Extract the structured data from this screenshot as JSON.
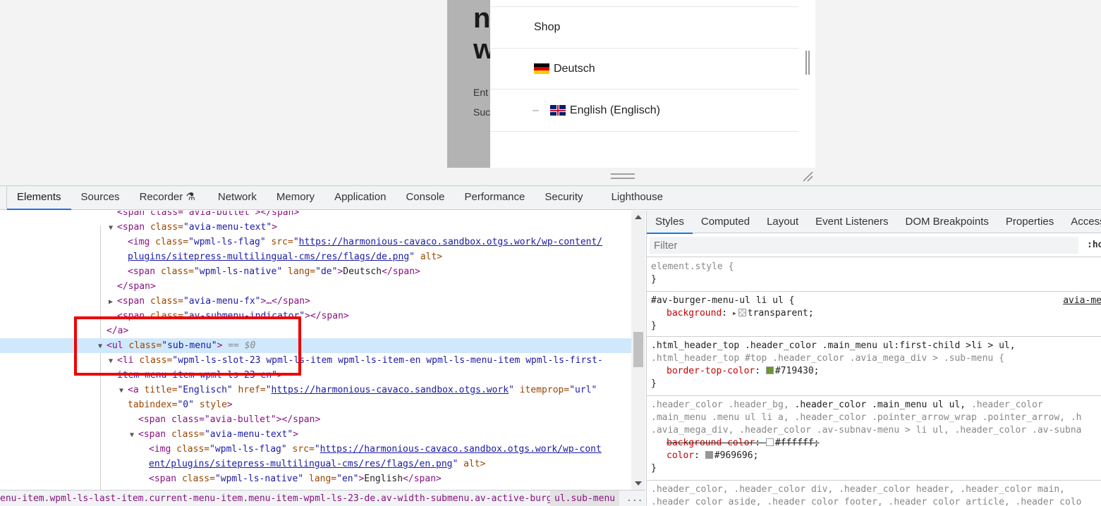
{
  "site": {
    "heading_line1": "n",
    "heading_line2": "w",
    "text_line1": "Ent",
    "text_line2": "Suc",
    "menu": {
      "shop": "Shop",
      "deutsch": "Deutsch",
      "english_dash": "–",
      "english": "English (Englisch)"
    }
  },
  "devtools": {
    "tabs": [
      "Elements",
      "Sources",
      "Recorder ⚗",
      "Network",
      "Memory",
      "Application",
      "Console",
      "Performance",
      "Security",
      "Lighthouse"
    ],
    "active_tab": "Elements",
    "dom": {
      "l0": "<span class=\"avia-bullet\"></span>",
      "l1_tag_open": "<span ",
      "l1_attr": "class=",
      "l1_val": "\"avia-menu-text\"",
      "l1_close": ">",
      "l2_pre": "<img ",
      "l2_attr1": "class=",
      "l2_val1": "\"wpml-ls-flag\"",
      "l2_attr2": " src=",
      "l2_link1": "https://harmonious-cavaco.sandbox.otgs.work/wp-content/",
      "l3_link2": "plugins/sitepress-multilingual-cms/res/flags/de.png",
      "l3_after": " alt>",
      "l4_open": "<span ",
      "l4_attr1": "class=",
      "l4_val1": "\"wpml-ls-native\"",
      "l4_attr2": " lang=",
      "l4_val2": "\"de\"",
      "l4_text": "Deutsch",
      "l4_close": "</span>",
      "l5": "</span>",
      "l6_open": "<span ",
      "l6_attr": "class=",
      "l6_val": "\"avia-menu-fx\"",
      "l6_rest": ">…</span>",
      "l7_open": "<span ",
      "l7_attr": "class=",
      "l7_val": "\"av-submenu-indicator\"",
      "l7_rest": "></span>",
      "l8": "</a>",
      "l9_open": "<ul ",
      "l9_attr": "class=",
      "l9_val": "\"sub-menu\"",
      "l9_close": ">",
      "l9_eq": " == $0",
      "l10_open": "<li ",
      "l10_attr": "class=",
      "l10_val": "\"wpml-ls-slot-23 wpml-ls-item wpml-ls-item-en wpml-ls-menu-item wpml-ls-first-",
      "l11_val": "item menu-item-wpml-ls-23-en\"",
      "l11_close": ">",
      "l12_open": "<a ",
      "l12_attr1": "title=",
      "l12_val1": "\"Englisch\"",
      "l12_attr2": " href=",
      "l12_link": "https://harmonious-cavaco.sandbox.otgs.work",
      "l12_attr3": " itemprop=",
      "l12_val3": "\"url\"",
      "l13_attr": "tabindex=",
      "l13_val": "\"0\"",
      "l13_attr2": " style",
      "l13_close": ">",
      "l14": "<span class=\"avia-bullet\"></span>",
      "l15_open": "<span ",
      "l15_attr": "class=",
      "l15_val": "\"avia-menu-text\"",
      "l15_close": ">",
      "l16_open": "<img ",
      "l16_attr1": "class=",
      "l16_val1": "\"wpml-ls-flag\"",
      "l16_attr2": " src=",
      "l16_link": "https://harmonious-cavaco.sandbox.otgs.work/wp-cont",
      "l17_link": "ent/plugins/sitepress-multilingual-cms/res/flags/en.png",
      "l17_after": " alt>",
      "l18_open": "<span ",
      "l18_attr1": "class=",
      "l18_val1": "\"wpml-ls-native\"",
      "l18_attr2": " lang=",
      "l18_val2": "\"en\"",
      "l18_text": "English",
      "l18_close": "</span>"
    },
    "breadcrumbs": {
      "left": "enu-item.wpml-ls-last-item.current-menu-item.menu-item-wpml-ls-23-de.av-width-submenu.av-active-burger-items",
      "active": "ul.sub-menu",
      "more": "..."
    },
    "styles": {
      "tabs": [
        "Styles",
        "Computed",
        "Layout",
        "Event Listeners",
        "DOM Breakpoints",
        "Properties",
        "Accessib"
      ],
      "active_tab": "Styles",
      "filter_placeholder": "Filter",
      "hov": ":ho",
      "r1_sel": "element.style {",
      "r1_close": "}",
      "r2_sel": "#av-burger-menu-ul li ul {",
      "r2_src": "avia-me",
      "r2_prop": "background",
      "r2_val": "transparent;",
      "r2_close": "}",
      "r3_sel1": ".html_header_top .header_color .main_menu ul:first-child >li > ul,",
      "r3_sel2": ".html_header_top #top .header_color .avia_mega_div > .sub-menu {",
      "r3_prop": "border-top-color",
      "r3_val": "#719430;",
      "r3_color": "#719430",
      "r3_close": "}",
      "r4_sel1a": ".header_color .header_bg, ",
      "r4_sel1b": ".header_color .main_menu ul ul, ",
      "r4_sel1c": ".header_color",
      "r4_sel2": ".main_menu .menu ul li a, .header_color .pointer_arrow_wrap .pointer_arrow, .h",
      "r4_sel3": ".avia_mega_div, .header_color .av-subnav-menu > li ul, .header_color .av-subna",
      "r4_prop1": "background-color",
      "r4_val1": "#ffffff;",
      "r4_prop2": "color",
      "r4_val2": "#969696;",
      "r4_color2": "#969696",
      "r4_close": "}",
      "r5_sel1": ".header_color, .header_color div, .header_color header, .header_color main,",
      "r5_sel2": ".header_color aside, .header_color footer, .header_color article, .header_colo"
    }
  }
}
